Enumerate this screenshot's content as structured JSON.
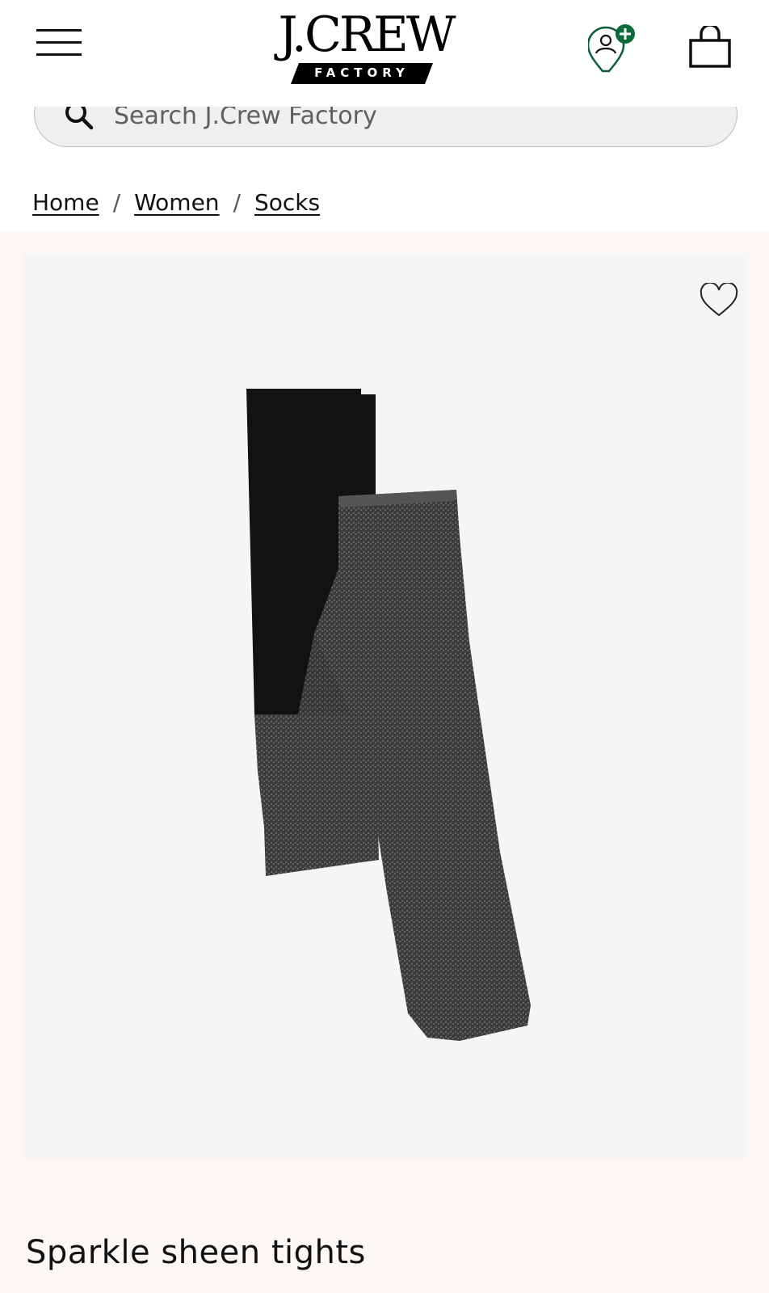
{
  "header": {
    "menu_icon": "hamburger-menu-icon",
    "logo_text": "J.CREW",
    "logo_subtext": "FACTORY",
    "account_icon": "user-location-plus-icon",
    "account_badge_color": "#0b6b3a",
    "bag_icon": "shopping-bag-icon"
  },
  "search": {
    "placeholder": "Search J.Crew Factory",
    "value": "",
    "icon": "search-icon"
  },
  "breadcrumb": {
    "items": [
      "Home",
      "Women",
      "Socks"
    ],
    "separator": "/"
  },
  "product": {
    "favorite_icon": "heart-icon",
    "title": "Sparkle sheen tights",
    "image_description_icon": "tights-image"
  },
  "colors": {
    "page_bg": "#faf7f4",
    "image_bg": "#f5f5f5",
    "text": "#111111"
  }
}
